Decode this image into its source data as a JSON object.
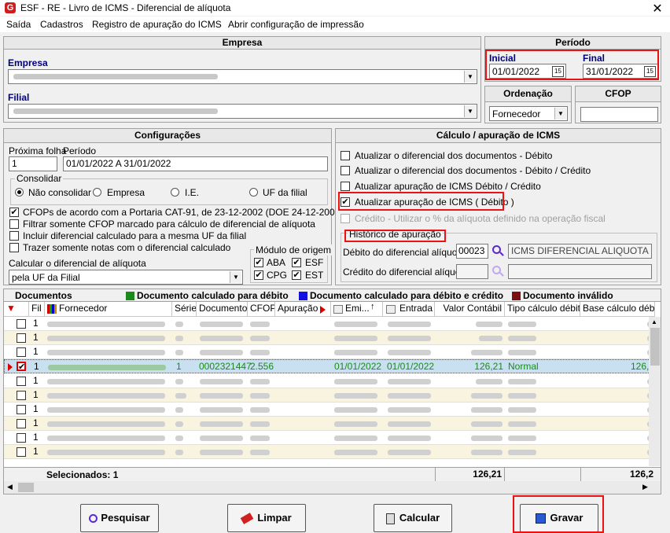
{
  "window": {
    "title": "ESF - RE - Livro de ICMS - Diferencial de alíquota",
    "logo": "G",
    "close": "✕"
  },
  "menu": [
    "Saída",
    "Cadastros",
    "Registro de apuração do ICMS",
    "Abrir configuração de impressão"
  ],
  "empresa": {
    "header": "Empresa",
    "empresa_label": "Empresa",
    "filial_label": "Filial"
  },
  "periodo": {
    "header": "Período",
    "inicial_label": "Inicial",
    "inicial_value": "01/01/2022",
    "final_label": "Final",
    "final_value": "31/01/2022"
  },
  "ordenacao": {
    "header": "Ordenação",
    "value": "Fornecedor"
  },
  "cfop": {
    "header": "CFOP",
    "value": ""
  },
  "config": {
    "header": "Configurações",
    "proxima_folha_label": "Próxima folha",
    "proxima_folha_value": "1",
    "periodo_label": "Período",
    "periodo_value": "01/01/2022 A 31/01/2022",
    "consolidar_label": "Consolidar",
    "radios": [
      "Não consolidar",
      "Empresa",
      "I.E.",
      "UF da filial"
    ],
    "checks": [
      {
        "label": "CFOPs de acordo com a Portaria CAT-91, de 23-12-2002 (DOE 24-12-2002)",
        "checked": "✔"
      },
      {
        "label": "Filtrar somente CFOP marcado para cálculo de diferencial de alíquota",
        "checked": ""
      },
      {
        "label": "Incluir diferencial calculado para a mesma UF da filial",
        "checked": ""
      },
      {
        "label": "Trazer somente notas com o diferencial calculado",
        "checked": ""
      }
    ],
    "calcular_label": "Calcular o diferencial de alíquota",
    "calcular_value": "pela UF da Filial",
    "modulo_label": "Módulo de origem",
    "modulos": [
      "ABA",
      "ESF",
      "CPG",
      "EST"
    ]
  },
  "calculo": {
    "header": "Cálculo / apuração de ICMS",
    "checks": [
      {
        "label": "Atualizar o diferencial dos documentos - Débito",
        "checked": ""
      },
      {
        "label": "Atualizar o diferencial dos documentos - Débito / Crédito",
        "checked": ""
      },
      {
        "label": "Atualizar apuração de ICMS Débito / Crédito",
        "checked": ""
      },
      {
        "label": "Atualizar apuração de ICMS ( Débito )",
        "checked": "✔"
      }
    ],
    "disabled_check": "Crédito - Utilizar o % da alíquota definido na operação fiscal",
    "historico_label": "Histórico de apuração",
    "debito_label": "Débito do diferencial alíquota",
    "debito_code": "00023",
    "debito_desc": "ICMS DIFERENCIAL ALIQUOTA",
    "credito_label": "Crédito do diferencial alíquota"
  },
  "documentos": {
    "header": "Documentos",
    "legend": [
      {
        "label": "Documento calculado para débito",
        "color": "#1a8a1a"
      },
      {
        "label": "Documento calculado para débito e crédito",
        "color": "#1010e0"
      },
      {
        "label": "Documento inválido",
        "color": "#7a1010"
      }
    ],
    "columns": [
      "Fil",
      "Fornecedor",
      "Série",
      "Documento",
      "CFOP",
      "Apuração",
      "Emi...",
      "Entrada",
      "Valor Contábil",
      "Tipo cálculo débito",
      "Base cálculo débi"
    ],
    "selected_row": {
      "fil": "1",
      "serie": "1",
      "documento": "0002321447",
      "cfop": "2.556",
      "emissao": "01/01/2022",
      "entrada": "01/01/2022",
      "valor": "126,21",
      "tipo": "Normal",
      "base": "126,2"
    },
    "other_fil": "1",
    "footer_label": "Selecionados: 1",
    "footer_total": "126,21",
    "footer_base": "126,2"
  },
  "buttons": {
    "pesquisar": "Pesquisar",
    "limpar": "Limpar",
    "calcular": "Calcular",
    "gravar": "Gravar"
  }
}
